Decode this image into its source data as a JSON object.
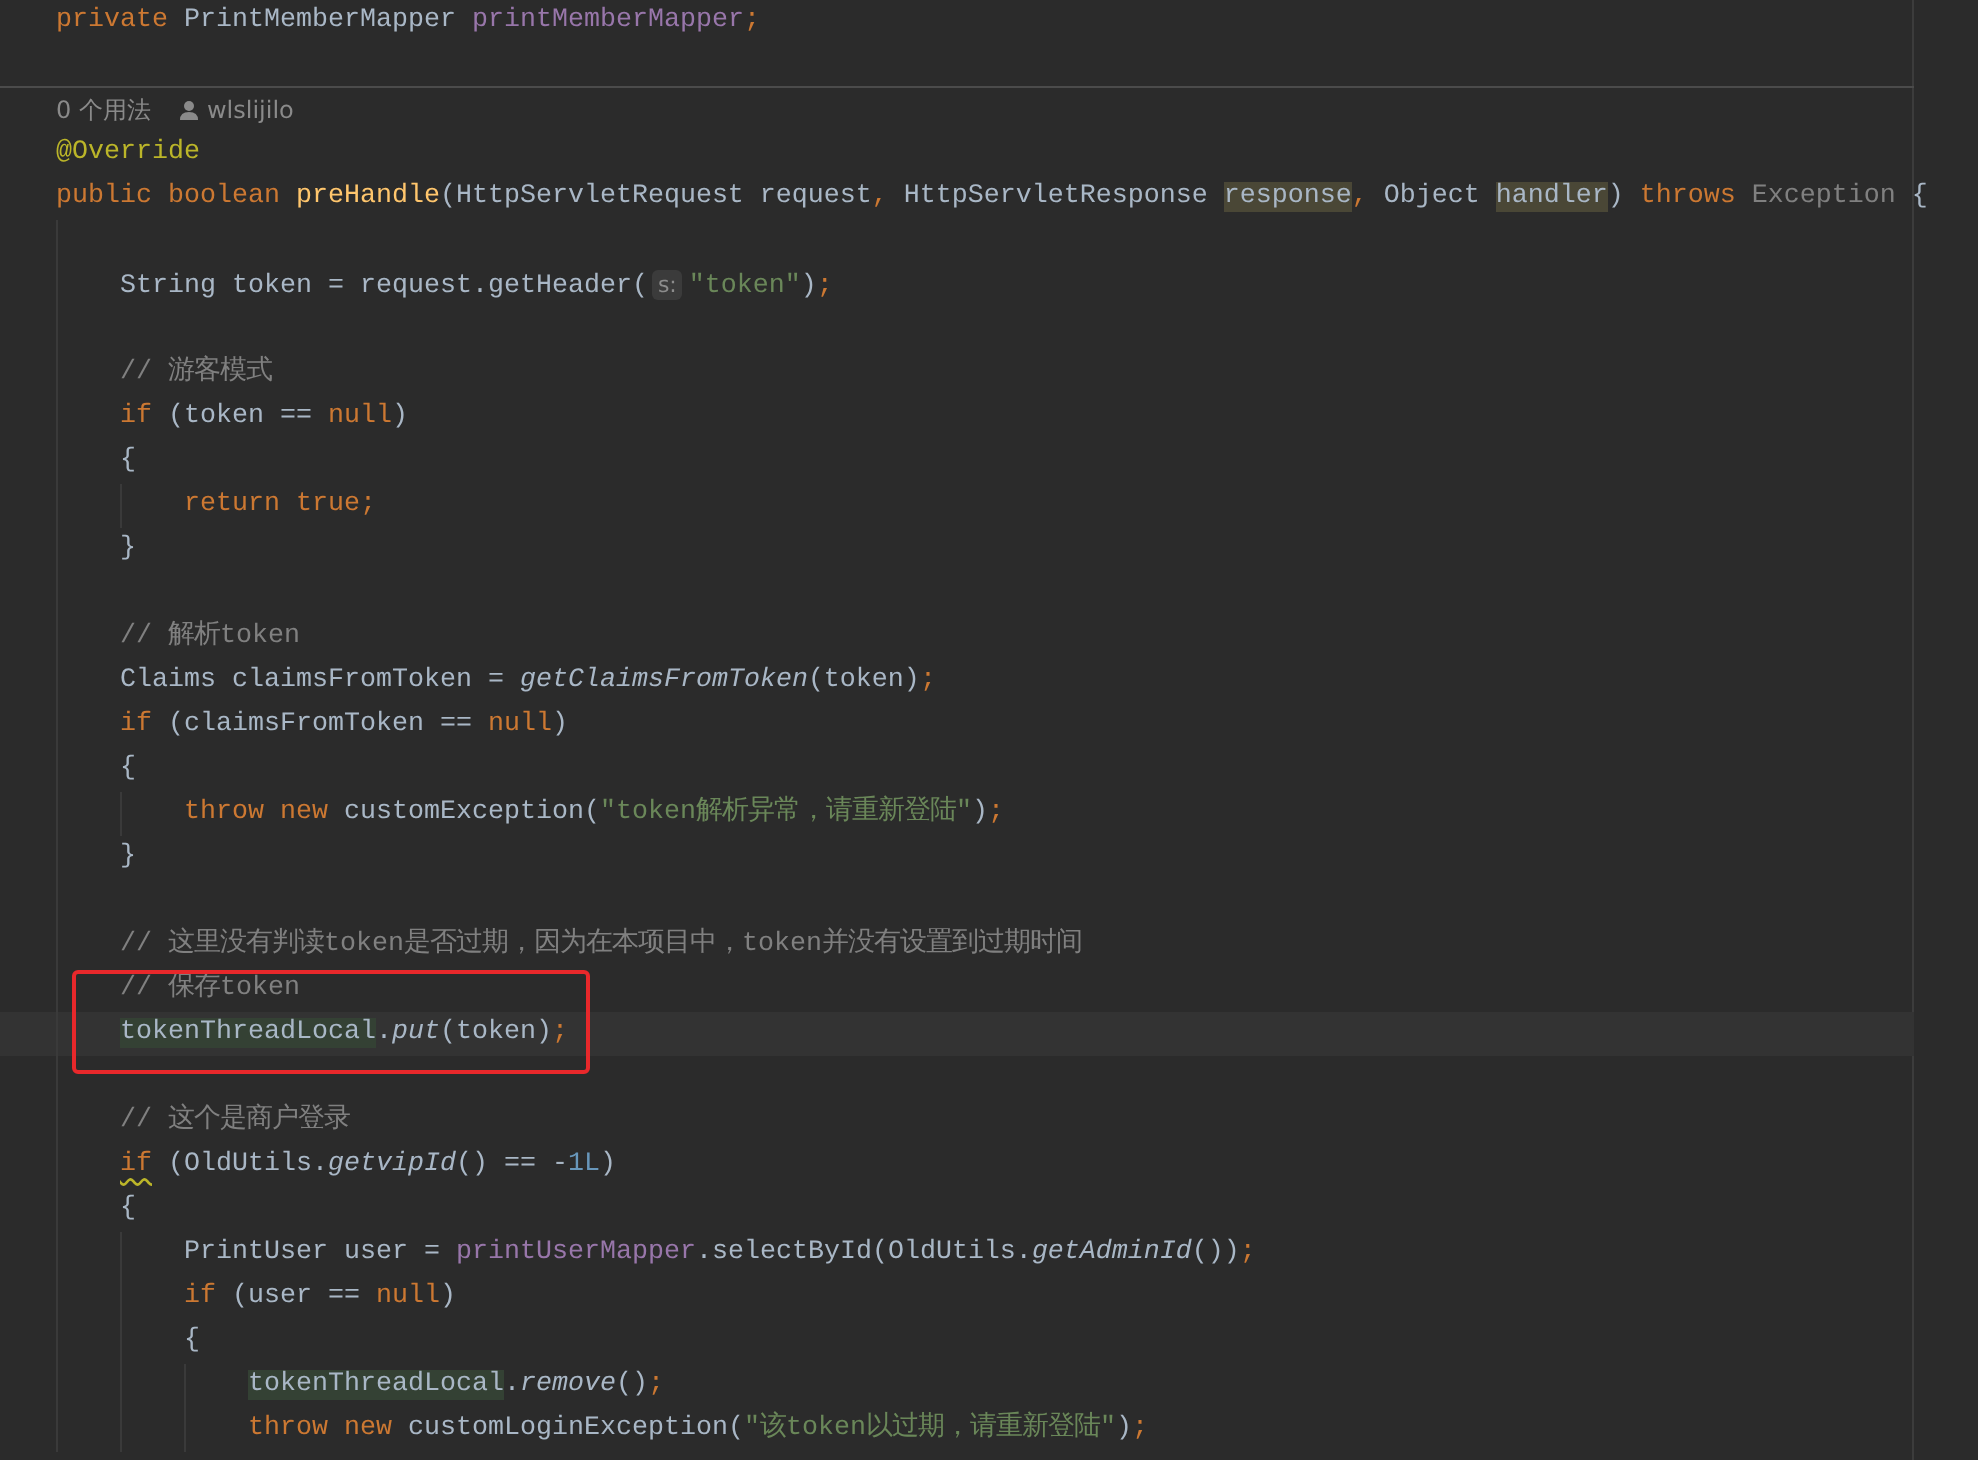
{
  "editor": {
    "lines": [
      {
        "kind": "code",
        "tokens": [
          {
            "kind": "keyword",
            "text": "private "
          },
          {
            "kind": "plain",
            "text": "PrintMemberMapper "
          },
          {
            "kind": "field",
            "text": "printMemberMapper"
          },
          {
            "kind": "keyword",
            "text": ";"
          }
        ]
      },
      {
        "kind": "blank"
      },
      {
        "kind": "usage",
        "usages": "0 个用法",
        "author": "wlslijilo"
      },
      {
        "kind": "code",
        "tokens": [
          {
            "kind": "annotation",
            "text": "@Override"
          }
        ]
      },
      {
        "kind": "code",
        "tokens": [
          {
            "kind": "keyword",
            "text": "public boolean "
          },
          {
            "kind": "method",
            "text": "preHandle"
          },
          {
            "kind": "plain",
            "text": "(HttpServletRequest request"
          },
          {
            "kind": "keyword",
            "text": ", "
          },
          {
            "kind": "plain",
            "text": "HttpServletResponse "
          },
          {
            "kind": "usage-highlight",
            "text": "response"
          },
          {
            "kind": "keyword",
            "text": ", "
          },
          {
            "kind": "plain",
            "text": "Object "
          },
          {
            "kind": "usage-highlight",
            "text": "handler"
          },
          {
            "kind": "plain",
            "text": ") "
          },
          {
            "kind": "keyword",
            "text": "throws "
          },
          {
            "kind": "unused",
            "text": "Exception "
          },
          {
            "kind": "plain",
            "text": "{"
          }
        ]
      },
      {
        "kind": "block",
        "children": [
          {
            "kind": "blank"
          },
          {
            "kind": "code",
            "tokens": [
              {
                "kind": "plain",
                "text": "String token = request.getHeader("
              },
              {
                "kind": "hint",
                "text": "s:"
              },
              {
                "kind": "string",
                "text": "\"token\""
              },
              {
                "kind": "plain",
                "text": ")"
              },
              {
                "kind": "keyword",
                "text": ";"
              }
            ]
          },
          {
            "kind": "blank"
          },
          {
            "kind": "code",
            "tokens": [
              {
                "kind": "comment",
                "text": "// 游客模式"
              }
            ]
          },
          {
            "kind": "code",
            "tokens": [
              {
                "kind": "keyword",
                "text": "if "
              },
              {
                "kind": "plain",
                "text": "(token == "
              },
              {
                "kind": "keyword",
                "text": "null"
              },
              {
                "kind": "plain",
                "text": ")"
              }
            ]
          },
          {
            "kind": "code",
            "tokens": [
              {
                "kind": "plain",
                "text": "{"
              }
            ]
          },
          {
            "kind": "block",
            "children": [
              {
                "kind": "code",
                "tokens": [
                  {
                    "kind": "keyword",
                    "text": "return true;"
                  }
                ]
              }
            ]
          },
          {
            "kind": "code",
            "tokens": [
              {
                "kind": "plain",
                "text": "}"
              }
            ]
          },
          {
            "kind": "blank"
          },
          {
            "kind": "code",
            "tokens": [
              {
                "kind": "comment",
                "text": "// 解析token"
              }
            ]
          },
          {
            "kind": "code",
            "tokens": [
              {
                "kind": "plain",
                "text": "Claims claimsFromToken = "
              },
              {
                "kind": "static-call",
                "text": "getClaimsFromToken"
              },
              {
                "kind": "plain",
                "text": "(token)"
              },
              {
                "kind": "keyword",
                "text": ";"
              }
            ]
          },
          {
            "kind": "code",
            "tokens": [
              {
                "kind": "keyword",
                "text": "if "
              },
              {
                "kind": "plain",
                "text": "(claimsFromToken == "
              },
              {
                "kind": "keyword",
                "text": "null"
              },
              {
                "kind": "plain",
                "text": ")"
              }
            ]
          },
          {
            "kind": "code",
            "tokens": [
              {
                "kind": "plain",
                "text": "{"
              }
            ]
          },
          {
            "kind": "block",
            "children": [
              {
                "kind": "code",
                "tokens": [
                  {
                    "kind": "keyword",
                    "text": "throw new "
                  },
                  {
                    "kind": "plain",
                    "text": "customException("
                  },
                  {
                    "kind": "string",
                    "text": "\"token解析异常，请重新登陆\""
                  },
                  {
                    "kind": "plain",
                    "text": ")"
                  },
                  {
                    "kind": "keyword",
                    "text": ";"
                  }
                ]
              }
            ]
          },
          {
            "kind": "code",
            "tokens": [
              {
                "kind": "plain",
                "text": "}"
              }
            ]
          },
          {
            "kind": "blank"
          },
          {
            "kind": "code",
            "tokens": [
              {
                "kind": "comment",
                "text": "// 这里没有判读token是否过期，因为在本项目中，token并没有设置到过期时间"
              }
            ]
          },
          {
            "kind": "boxed",
            "children": [
              {
                "kind": "code",
                "tokens": [
                  {
                    "kind": "comment",
                    "text": "// 保存token"
                  }
                ]
              },
              {
                "kind": "current-line",
                "tokens": [
                  {
                    "kind": "write-highlight",
                    "text": "tokenThreadLocal"
                  },
                  {
                    "kind": "plain",
                    "text": "."
                  },
                  {
                    "kind": "static-call",
                    "text": "put"
                  },
                  {
                    "kind": "plain",
                    "text": "(token)"
                  },
                  {
                    "kind": "keyword",
                    "text": ";"
                  }
                ]
              }
            ]
          },
          {
            "kind": "blank"
          },
          {
            "kind": "code",
            "tokens": [
              {
                "kind": "comment",
                "text": "// 这个是商户登录"
              }
            ]
          },
          {
            "kind": "code",
            "tokens": [
              {
                "kind": "keyword-warning",
                "text": "if"
              },
              {
                "kind": "plain",
                "text": " (OldUtils."
              },
              {
                "kind": "static-call",
                "text": "getvipId"
              },
              {
                "kind": "plain",
                "text": "() == -"
              },
              {
                "kind": "number",
                "text": "1L"
              },
              {
                "kind": "plain",
                "text": ")"
              }
            ]
          },
          {
            "kind": "code",
            "tokens": [
              {
                "kind": "plain",
                "text": "{"
              }
            ]
          },
          {
            "kind": "block",
            "children": [
              {
                "kind": "code",
                "tokens": [
                  {
                    "kind": "plain",
                    "text": "PrintUser user = "
                  },
                  {
                    "kind": "field",
                    "text": "printUserMapper"
                  },
                  {
                    "kind": "plain",
                    "text": ".selectById(OldUtils."
                  },
                  {
                    "kind": "static-call",
                    "text": "getAdminId"
                  },
                  {
                    "kind": "plain",
                    "text": "())"
                  },
                  {
                    "kind": "keyword",
                    "text": ";"
                  }
                ]
              },
              {
                "kind": "code",
                "tokens": [
                  {
                    "kind": "keyword",
                    "text": "if "
                  },
                  {
                    "kind": "plain",
                    "text": "(user == "
                  },
                  {
                    "kind": "keyword",
                    "text": "null"
                  },
                  {
                    "kind": "plain",
                    "text": ")"
                  }
                ]
              },
              {
                "kind": "code",
                "tokens": [
                  {
                    "kind": "plain",
                    "text": "{"
                  }
                ]
              },
              {
                "kind": "block",
                "children": [
                  {
                    "kind": "code",
                    "tokens": [
                      {
                        "kind": "write-highlight",
                        "text": "tokenThreadLocal"
                      },
                      {
                        "kind": "plain",
                        "text": "."
                      },
                      {
                        "kind": "static-call",
                        "text": "remove"
                      },
                      {
                        "kind": "plain",
                        "text": "()"
                      },
                      {
                        "kind": "keyword",
                        "text": ";"
                      }
                    ]
                  },
                  {
                    "kind": "code",
                    "tokens": [
                      {
                        "kind": "keyword",
                        "text": "throw new "
                      },
                      {
                        "kind": "plain",
                        "text": "customLoginException("
                      },
                      {
                        "kind": "string",
                        "text": "\"该token以过期，请重新登陆\""
                      },
                      {
                        "kind": "plain",
                        "text": ")"
                      },
                      {
                        "kind": "keyword",
                        "text": ";"
                      }
                    ]
                  }
                ]
              }
            ]
          }
        ]
      }
    ]
  }
}
